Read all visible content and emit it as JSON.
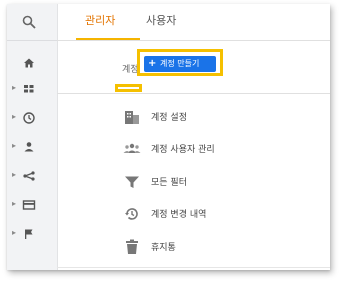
{
  "tabs": [
    {
      "label": "관리자",
      "active": true
    },
    {
      "label": "사용자",
      "active": false
    }
  ],
  "account": {
    "label": "계정",
    "create_button": "계정 만들기"
  },
  "menu": [
    {
      "label": "계정 설정",
      "icon": "building-icon"
    },
    {
      "label": "계정 사용자 관리",
      "icon": "people-icon"
    },
    {
      "label": "모든 필터",
      "icon": "filter-icon"
    },
    {
      "label": "계정 변경 내역",
      "icon": "history-icon"
    },
    {
      "label": "휴지통",
      "icon": "trash-icon"
    }
  ],
  "rail_icons": [
    "search-icon",
    "home-icon",
    "dashboard-icon",
    "clock-icon",
    "person-icon",
    "flow-icon",
    "card-icon",
    "flag-icon"
  ],
  "colors": {
    "accent": "#e37400",
    "highlight": "#f5c000",
    "button": "#1a73e8"
  }
}
